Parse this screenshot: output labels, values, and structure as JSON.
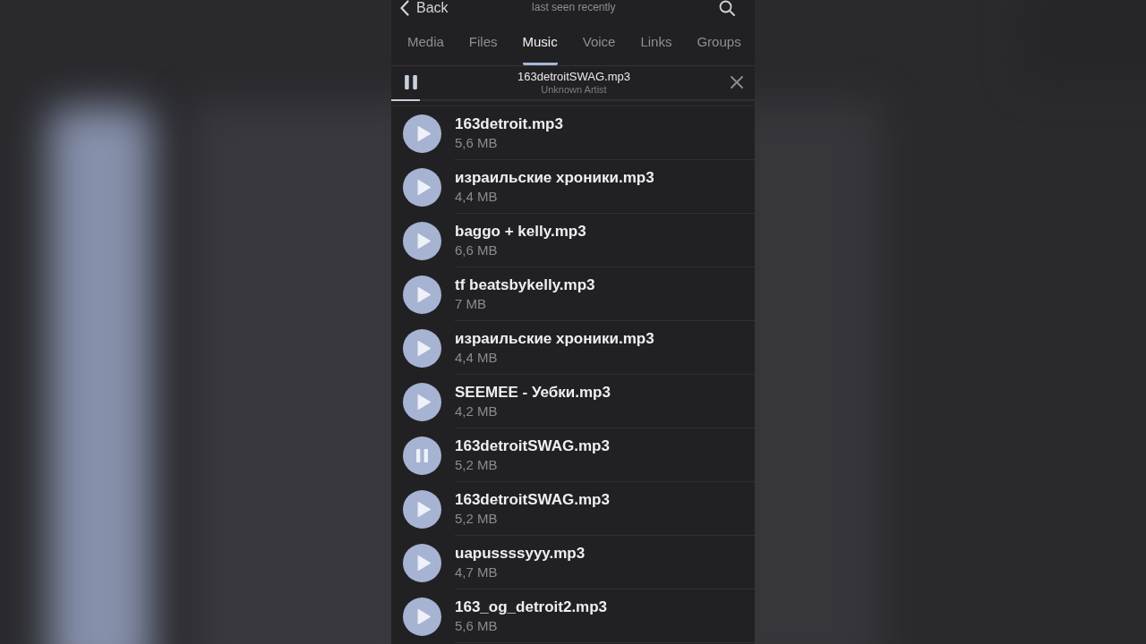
{
  "header": {
    "back_label": "Back",
    "subtitle": "last seen recently"
  },
  "tabs": [
    {
      "label": "Media",
      "selected": false
    },
    {
      "label": "Files",
      "selected": false
    },
    {
      "label": "Music",
      "selected": true
    },
    {
      "label": "Voice",
      "selected": false
    },
    {
      "label": "Links",
      "selected": false
    },
    {
      "label": "Groups",
      "selected": false
    }
  ],
  "player": {
    "title": "163detroitSWAG.mp3",
    "artist": "Unknown Artist",
    "playing": true,
    "level": 0.08
  },
  "tracks": [
    {
      "name": "163detroit.mp3",
      "size": "5,6 MB",
      "playing": false
    },
    {
      "name": "израильские хроники.mp3",
      "size": "4,4 MB",
      "playing": false
    },
    {
      "name": "baggo + kelly.mp3",
      "size": "6,6 MB",
      "playing": false
    },
    {
      "name": "tf beatsbykelly.mp3",
      "size": "7 MB",
      "playing": false
    },
    {
      "name": "израильские хроники.mp3",
      "size": "4,4 MB",
      "playing": false
    },
    {
      "name": "SEEMEE - Уебки.mp3",
      "size": "4,2 MB",
      "playing": false
    },
    {
      "name": "163detroitSWAG.mp3",
      "size": "5,2 MB",
      "playing": true
    },
    {
      "name": "163detroitSWAG.mp3",
      "size": "5,2 MB",
      "playing": false
    },
    {
      "name": "uapussssyyy.mp3",
      "size": "4,7 MB",
      "playing": false
    },
    {
      "name": "163_og_detroit2.mp3",
      "size": "5,6 MB",
      "playing": false
    }
  ]
}
